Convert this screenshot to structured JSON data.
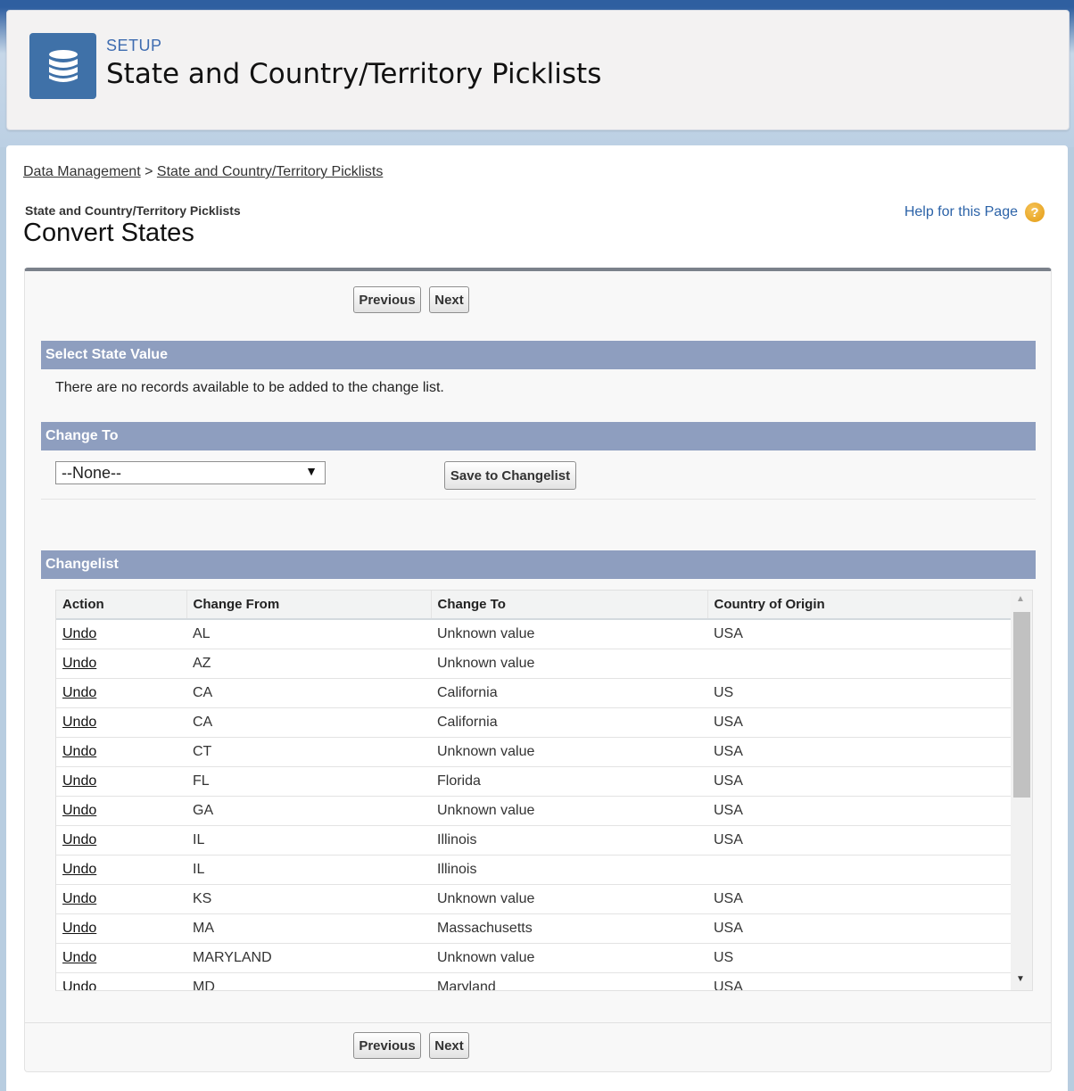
{
  "header": {
    "setup_label": "SETUP",
    "title": "State and Country/Territory Picklists",
    "icon": "database-icon"
  },
  "breadcrumb": {
    "items": [
      "Data Management",
      "State and Country/Territory Picklists"
    ],
    "separator": ">"
  },
  "page": {
    "subtitle": "State and Country/Territory Picklists",
    "title": "Convert States",
    "help_label": "Help for this Page",
    "help_icon": "help-icon"
  },
  "nav": {
    "previous": "Previous",
    "next": "Next"
  },
  "select_state": {
    "title": "Select State Value",
    "message": "There are no records available to be added to the change list."
  },
  "change_to": {
    "title": "Change To",
    "selected": "--None--",
    "save_label": "Save to Changelist"
  },
  "changelist": {
    "title": "Changelist",
    "columns": [
      "Action",
      "Change From",
      "Change To",
      "Country of Origin"
    ],
    "rows": [
      {
        "action": "Undo",
        "from": "AL",
        "to": "Unknown value",
        "country": "USA"
      },
      {
        "action": "Undo",
        "from": "AZ",
        "to": "Unknown value",
        "country": ""
      },
      {
        "action": "Undo",
        "from": "CA",
        "to": "California",
        "country": "US"
      },
      {
        "action": "Undo",
        "from": "CA",
        "to": "California",
        "country": "USA"
      },
      {
        "action": "Undo",
        "from": "CT",
        "to": "Unknown value",
        "country": "USA"
      },
      {
        "action": "Undo",
        "from": "FL",
        "to": "Florida",
        "country": "USA"
      },
      {
        "action": "Undo",
        "from": "GA",
        "to": "Unknown value",
        "country": "USA"
      },
      {
        "action": "Undo",
        "from": "IL",
        "to": "Illinois",
        "country": "USA"
      },
      {
        "action": "Undo",
        "from": "IL",
        "to": "Illinois",
        "country": ""
      },
      {
        "action": "Undo",
        "from": "KS",
        "to": "Unknown value",
        "country": "USA"
      },
      {
        "action": "Undo",
        "from": "MA",
        "to": "Massachusetts",
        "country": "USA"
      },
      {
        "action": "Undo",
        "from": "MARYLAND",
        "to": "Unknown value",
        "country": "US"
      },
      {
        "action": "Undo",
        "from": "MD",
        "to": "Maryland",
        "country": "USA"
      }
    ]
  },
  "colors": {
    "section_bar": "#8e9ebf",
    "app_icon_bg": "#3f71a8",
    "accent_link": "#2c63a8"
  }
}
